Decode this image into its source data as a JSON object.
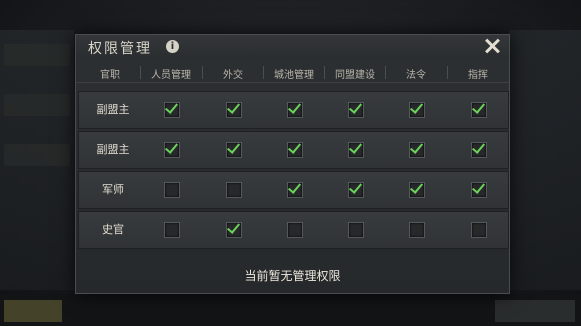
{
  "dialog": {
    "title": "权限管理",
    "info_icon": "i",
    "columns": [
      "官职",
      "人员管理",
      "外交",
      "城池管理",
      "同盟建设",
      "法令",
      "指挥"
    ],
    "rows": [
      {
        "label": "副盟主",
        "perms": [
          true,
          true,
          true,
          true,
          true,
          true
        ]
      },
      {
        "label": "副盟主",
        "perms": [
          true,
          true,
          true,
          true,
          true,
          true
        ]
      },
      {
        "label": "军师",
        "perms": [
          false,
          false,
          true,
          true,
          true,
          true
        ]
      },
      {
        "label": "史官",
        "perms": [
          false,
          true,
          false,
          false,
          false,
          false
        ]
      }
    ],
    "status": "当前暂无管理权限",
    "check_color": "#6bd25c"
  }
}
